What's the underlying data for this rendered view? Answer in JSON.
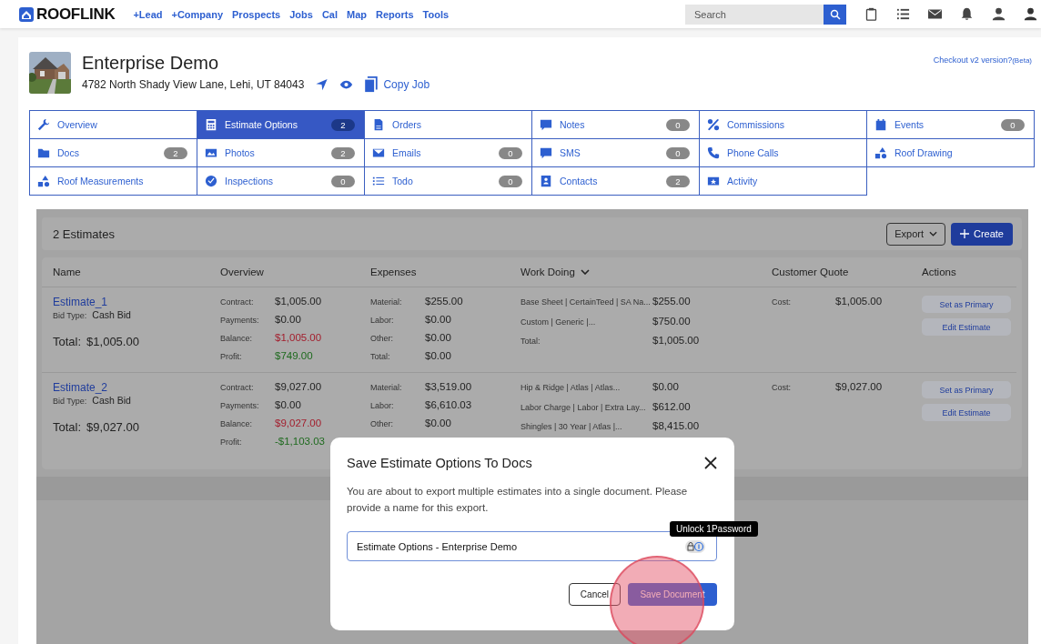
{
  "nav": {
    "brand": "ROOFLINK",
    "links": [
      "+Lead",
      "+Company",
      "Prospects",
      "Jobs",
      "Cal",
      "Map",
      "Reports",
      "Tools"
    ],
    "search": {
      "placeholder": "Search"
    }
  },
  "job": {
    "title": "Enterprise Demo",
    "address": "4782 North Shady View Lane, Lehi, UT 84043",
    "copy": "Copy Job",
    "checkout": "Checkout v2 version?",
    "checkout_note": "(Beta)"
  },
  "tabs": [
    {
      "label": "Overview",
      "selected": false
    },
    {
      "label": "Estimate Options",
      "count": "2",
      "selected": true
    },
    {
      "label": "Orders",
      "selected": false
    },
    {
      "label": "Notes",
      "count": "0",
      "selected": false
    },
    {
      "label": "Commissions",
      "selected": false
    },
    {
      "label": "Events",
      "count": "0",
      "selected": false
    },
    {
      "label": "Docs",
      "count": "2",
      "selected": false
    },
    {
      "label": "Photos",
      "count": "2",
      "selected": false
    },
    {
      "label": "Emails",
      "count": "0",
      "selected": false
    },
    {
      "label": "SMS",
      "count": "0",
      "selected": false
    },
    {
      "label": "Phone Calls",
      "selected": false
    },
    {
      "label": "Roof Drawing",
      "selected": false
    },
    {
      "label": "Roof Measurements",
      "selected": false
    },
    {
      "label": "Inspections",
      "count": "0",
      "selected": false
    },
    {
      "label": "Todo",
      "count": "0",
      "selected": false
    },
    {
      "label": "Contacts",
      "count": "2",
      "selected": false
    },
    {
      "label": "Activity",
      "selected": false
    }
  ],
  "estimates": {
    "heading": "2 Estimates",
    "export": "Export",
    "create": "Create",
    "columns": [
      "Name",
      "Overview",
      "Expenses",
      "Work Doing",
      "Customer Quote",
      "Actions"
    ],
    "rows": [
      {
        "name": "Estimate_1",
        "bid_label": "Bid Type:",
        "bid": "Cash Bid",
        "total_label": "Total:",
        "total": "$1,005.00",
        "overview": [
          {
            "label": "Contract:",
            "value": "$1,005.00",
            "color": "#222222"
          },
          {
            "label": "Payments:",
            "value": "$0.00",
            "color": "#222222"
          },
          {
            "label": "Balance:",
            "value": "$1,005.00",
            "color": "#a31d2c"
          },
          {
            "label": "Profit:",
            "value": "$749.00",
            "color": "#1e6a1e"
          }
        ],
        "expenses": [
          {
            "label": "Material:",
            "value": "$255.00"
          },
          {
            "label": "Labor:",
            "value": "$0.00"
          },
          {
            "label": "Other:",
            "value": "$0.00"
          },
          {
            "label": "Total:",
            "value": "$0.00"
          }
        ],
        "work": [
          {
            "label": "Base Sheet | CertainTeed | SA Na...",
            "value": "$255.00"
          },
          {
            "label": "Custom | Generic |...",
            "value": "$750.00"
          },
          {
            "label": "Total:",
            "value": "$1,005.00"
          }
        ],
        "quote": {
          "label": "Cost:",
          "value": "$1,005.00"
        },
        "actions": [
          "Set as Primary",
          "Edit Estimate"
        ]
      },
      {
        "name": "Estimate_2",
        "bid_label": "Bid Type:",
        "bid": "Cash Bid",
        "total_label": "Total:",
        "total": "$9,027.00",
        "overview": [
          {
            "label": "Contract:",
            "value": "$9,027.00",
            "color": "#222222"
          },
          {
            "label": "Payments:",
            "value": "$0.00",
            "color": "#222222"
          },
          {
            "label": "Balance:",
            "value": "$9,027.00",
            "color": "#a31d2c"
          },
          {
            "label": "Profit:",
            "value": "-$1,103.03",
            "color": "#1e6a1e"
          }
        ],
        "expenses": [
          {
            "label": "Material:",
            "value": "$3,519.00"
          },
          {
            "label": "Labor:",
            "value": "$6,610.03"
          },
          {
            "label": "Other:",
            "value": "$0.00"
          }
        ],
        "work": [
          {
            "label": "Hip & Ridge | Atlas | Atlas...",
            "value": "$0.00"
          },
          {
            "label": "Labor Charge | Labor | Extra Lay...",
            "value": "$612.00"
          },
          {
            "label": "Shingles | 30 Year | Atlas |...",
            "value": "$8,415.00"
          }
        ],
        "quote": {
          "label": "Cost:",
          "value": "$9,027.00"
        },
        "actions": [
          "Set as Primary",
          "Edit Estimate"
        ]
      }
    ]
  },
  "modal": {
    "title": "Save Estimate Options To Docs",
    "message": "You are about to export multiple estimates into a single document. Please provide a name for this export.",
    "field_value": "Estimate Options - Enterprise Demo",
    "tooltip": "Unlock 1Password",
    "cancel": "Cancel",
    "save": "Save Document"
  }
}
